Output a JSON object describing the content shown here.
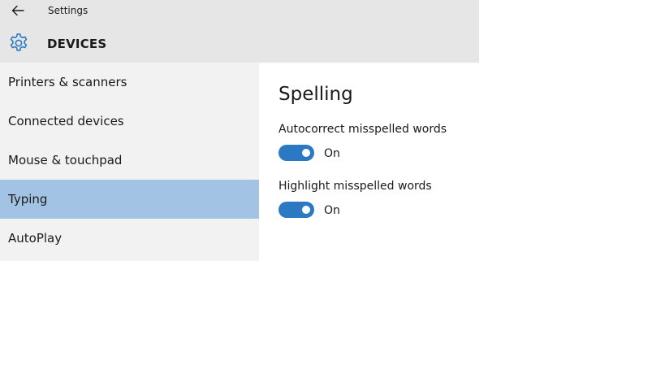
{
  "window": {
    "title": "Settings",
    "back_icon": "arrow-left-icon"
  },
  "header": {
    "category_icon": "gear-icon",
    "category_title": "DEVICES",
    "accent_color": "#2b79c2"
  },
  "sidebar": {
    "selected_index": 3,
    "selected_color": "#a2c3e4",
    "items": [
      {
        "label": "Printers & scanners"
      },
      {
        "label": "Connected devices"
      },
      {
        "label": "Mouse & touchpad"
      },
      {
        "label": "Typing"
      },
      {
        "label": "AutoPlay"
      }
    ]
  },
  "content": {
    "section_title": "Spelling",
    "settings": [
      {
        "label": "Autocorrect misspelled words",
        "state": "On",
        "enabled": true
      },
      {
        "label": "Highlight misspelled words",
        "state": "On",
        "enabled": true
      }
    ]
  }
}
